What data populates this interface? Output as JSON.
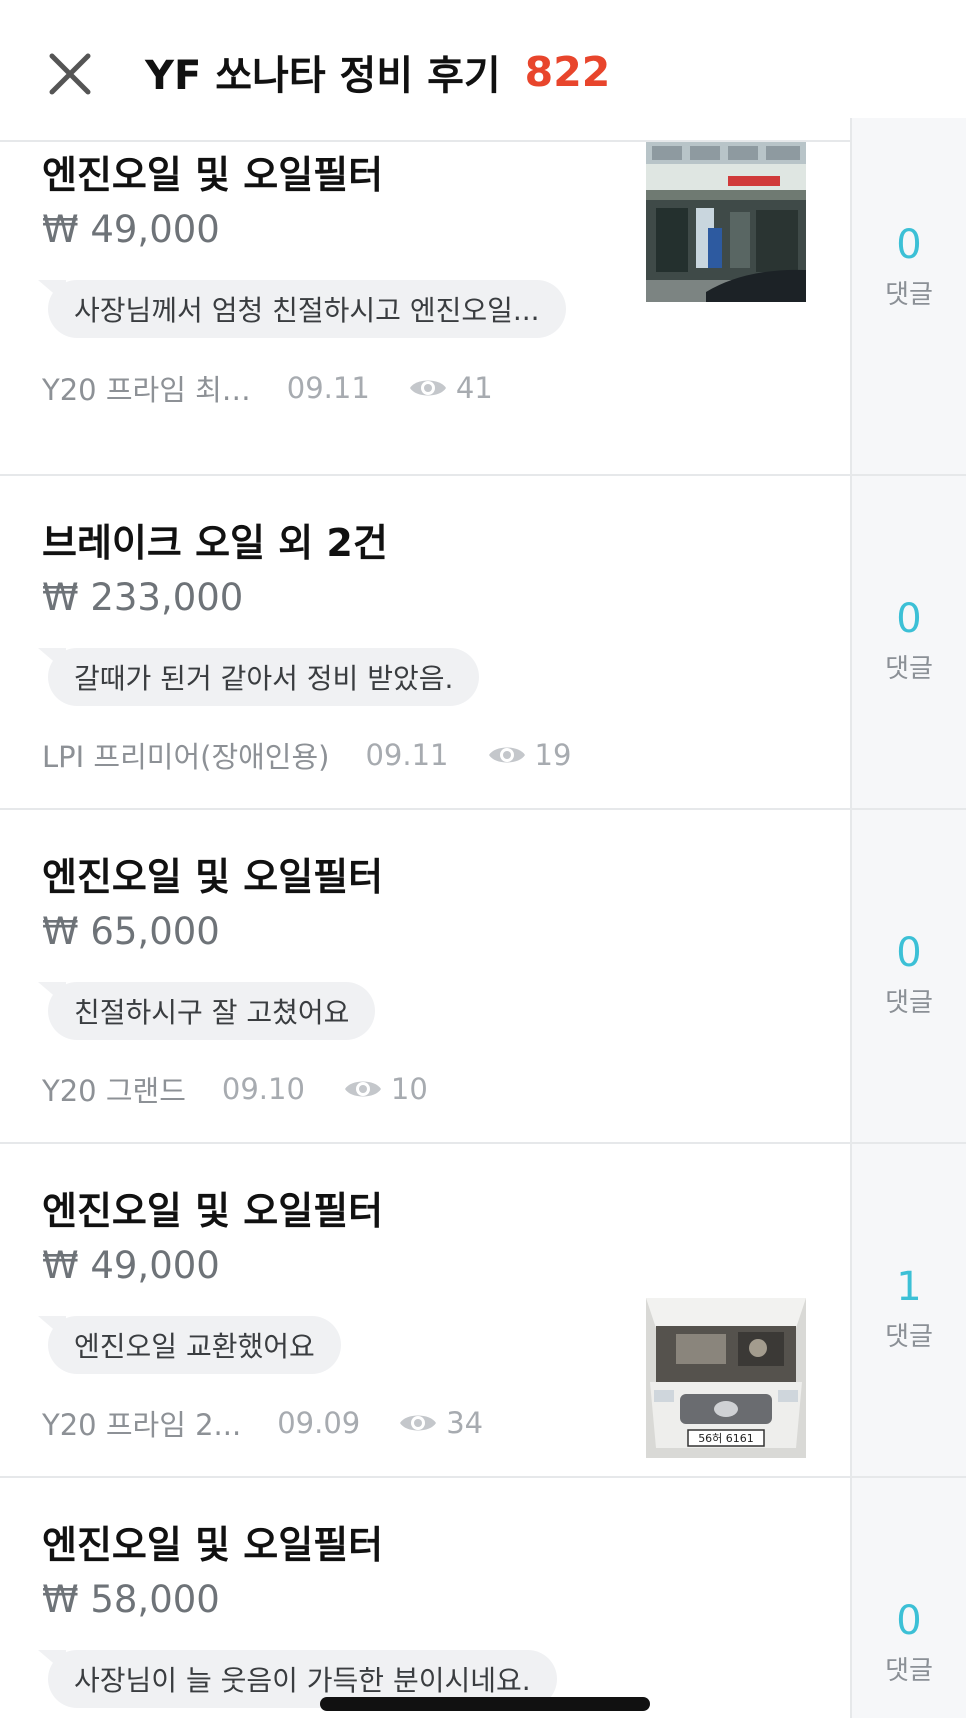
{
  "header": {
    "title": "YF 쏘나타 정비 후기",
    "count": "822"
  },
  "colors": {
    "accent_count": "#e8452c",
    "comment_count": "#3cc0d6",
    "divider": "#e6e8ea",
    "bubble_bg": "#f0f1f3",
    "side_bg": "#f6f7f9"
  },
  "items": [
    {
      "title": "엔진오일 및 오일필터",
      "price": "₩ 49,000",
      "comment": "사장님께서 엄청 친절하시고 엔진오일...",
      "trim": "Y20 프라임 최…",
      "date": "09.11",
      "views": "41",
      "comments": "0",
      "comments_label": "댓글",
      "has_thumb": true,
      "thumb_desc": "shop-storefront"
    },
    {
      "title": "브레이크 오일 외 2건",
      "price": "₩ 233,000",
      "comment": "갈때가 된거 같아서 정비 받았음.",
      "trim": "LPI 프리미어(장애인용)",
      "date": "09.11",
      "views": "19",
      "comments": "0",
      "comments_label": "댓글",
      "has_thumb": false
    },
    {
      "title": "엔진오일 및 오일필터",
      "price": "₩ 65,000",
      "comment": "친절하시구 잘 고쳤어요",
      "trim": "Y20 그랜드",
      "date": "09.10",
      "views": "10",
      "comments": "0",
      "comments_label": "댓글",
      "has_thumb": false
    },
    {
      "title": "엔진오일 및 오일필터",
      "price": "₩ 49,000",
      "comment": "엔진오일 교환했어요",
      "trim": "Y20 프라임 2...",
      "date": "09.09",
      "views": "34",
      "comments": "1",
      "comments_label": "댓글",
      "has_thumb": true,
      "thumb_desc": "car-engine-bay",
      "plate": "56허 6161"
    },
    {
      "title": "엔진오일 및 오일필터",
      "price": "₩ 58,000",
      "comment": "사장님이 늘 웃음이 가득한 분이시네요.",
      "comments": "0",
      "comments_label": "댓글",
      "has_thumb": false
    }
  ]
}
